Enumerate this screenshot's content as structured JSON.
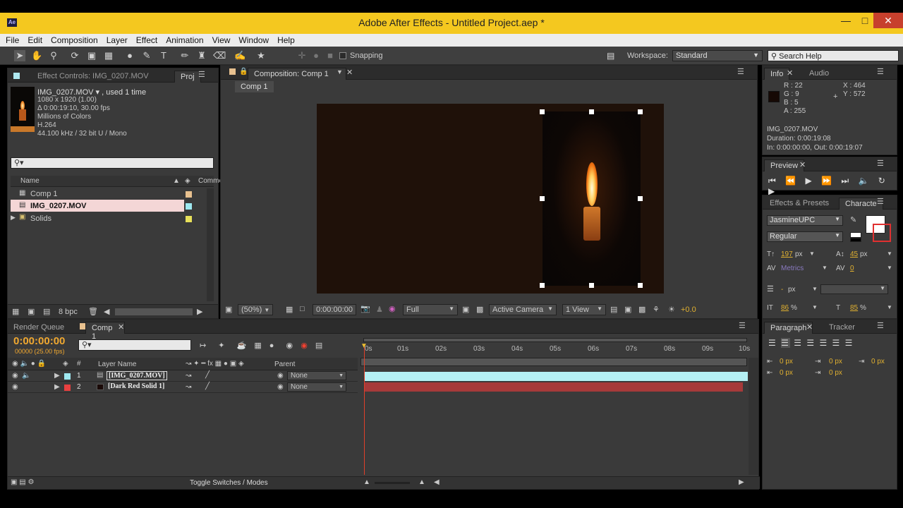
{
  "window": {
    "title": "Adobe After Effects - Untitled Project.aep *",
    "app_icon": "Ae"
  },
  "menu": [
    "File",
    "Edit",
    "Composition",
    "Layer",
    "Effect",
    "Animation",
    "View",
    "Window",
    "Help"
  ],
  "toolbar": {
    "snapping": "Snapping",
    "workspace_label": "Workspace:",
    "workspace_value": "Standard",
    "search_placeholder": "Search Help"
  },
  "project": {
    "tab_effect": "Effect Controls: IMG_0207.MOV",
    "tab_proj": "Proj",
    "file_name": "IMG_0207.MOV ▾ , used 1 time",
    "info_lines": [
      "1080 x 1920 (1.00)",
      "Δ 0:00:19:10, 30.00 fps",
      "Millions of Colors",
      "H.264",
      "44.100 kHz / 32 bit U / Mono"
    ],
    "col_name": "Name",
    "col_comment": "Comme",
    "items": [
      {
        "name": "Comp 1",
        "color": "#e8c18f"
      },
      {
        "name": "IMG_0207.MOV",
        "color": "#9ee8f0"
      },
      {
        "name": "Solids",
        "color": "#e8e05a"
      }
    ],
    "bpc": "8 bpc"
  },
  "comp": {
    "tab": "Composition: Comp 1",
    "subtab": "Comp 1",
    "zoom": "(50%)",
    "timecode": "0:00:00:00",
    "resolution": "Full",
    "camera": "Active Camera",
    "views": "1 View",
    "exposure": "+0.0"
  },
  "info": {
    "tab_info": "Info",
    "tab_audio": "Audio",
    "r": "R : 22",
    "g": "G : 9",
    "b": "B : 5",
    "a": "A : 255",
    "x": "X : 464",
    "y": "Y : 572",
    "lines": [
      "IMG_0207.MOV",
      "Duration: 0:00:19:08",
      "In: 0:00:00:00, Out: 0:00:19:07"
    ]
  },
  "preview": {
    "tab": "Preview"
  },
  "character": {
    "tab_effects": "Effects & Presets",
    "tab_char": "Characte",
    "font": "JasmineUPC",
    "style": "Regular",
    "size": "197",
    "size_unit": "px",
    "leading": "45",
    "leading_unit": "px",
    "kerning": "Metrics",
    "tracking": "0",
    "stroke": "-",
    "stroke_unit": "px",
    "vscale": "86",
    "vscale_unit": "%",
    "hscale": "85",
    "hscale_unit": "%"
  },
  "paragraph": {
    "tab": "Paragraph",
    "tab_tracker": "Tracker",
    "values": [
      "0 px",
      "0 px",
      "0 px",
      "0 px",
      "0 px"
    ]
  },
  "timeline": {
    "tab_render": "Render Queue",
    "tab_comp": "Comp 1",
    "time": "0:00:00:00",
    "frames": "00000 (25.00 fps)",
    "col_layer": "Layer Name",
    "col_parent": "Parent",
    "col_num": "#",
    "layers": [
      {
        "num": "1",
        "name": "[IMG_0207.MOV]",
        "color": "#9ee8f0",
        "parent": "None"
      },
      {
        "num": "2",
        "name": "[Dark Red Solid 1]",
        "color": "#e84040",
        "parent": "None"
      }
    ],
    "ruler": [
      "0s",
      "01s",
      "02s",
      "03s",
      "04s",
      "05s",
      "06s",
      "07s",
      "08s",
      "09s",
      "10s"
    ],
    "toggle": "Toggle Switches / Modes"
  },
  "colors": {
    "accent": "#f4c81f",
    "layer1": "#b4f0f4",
    "layer2": "#a63a3a",
    "cti": "#e0402a",
    "time_orange": "#f0a830"
  }
}
